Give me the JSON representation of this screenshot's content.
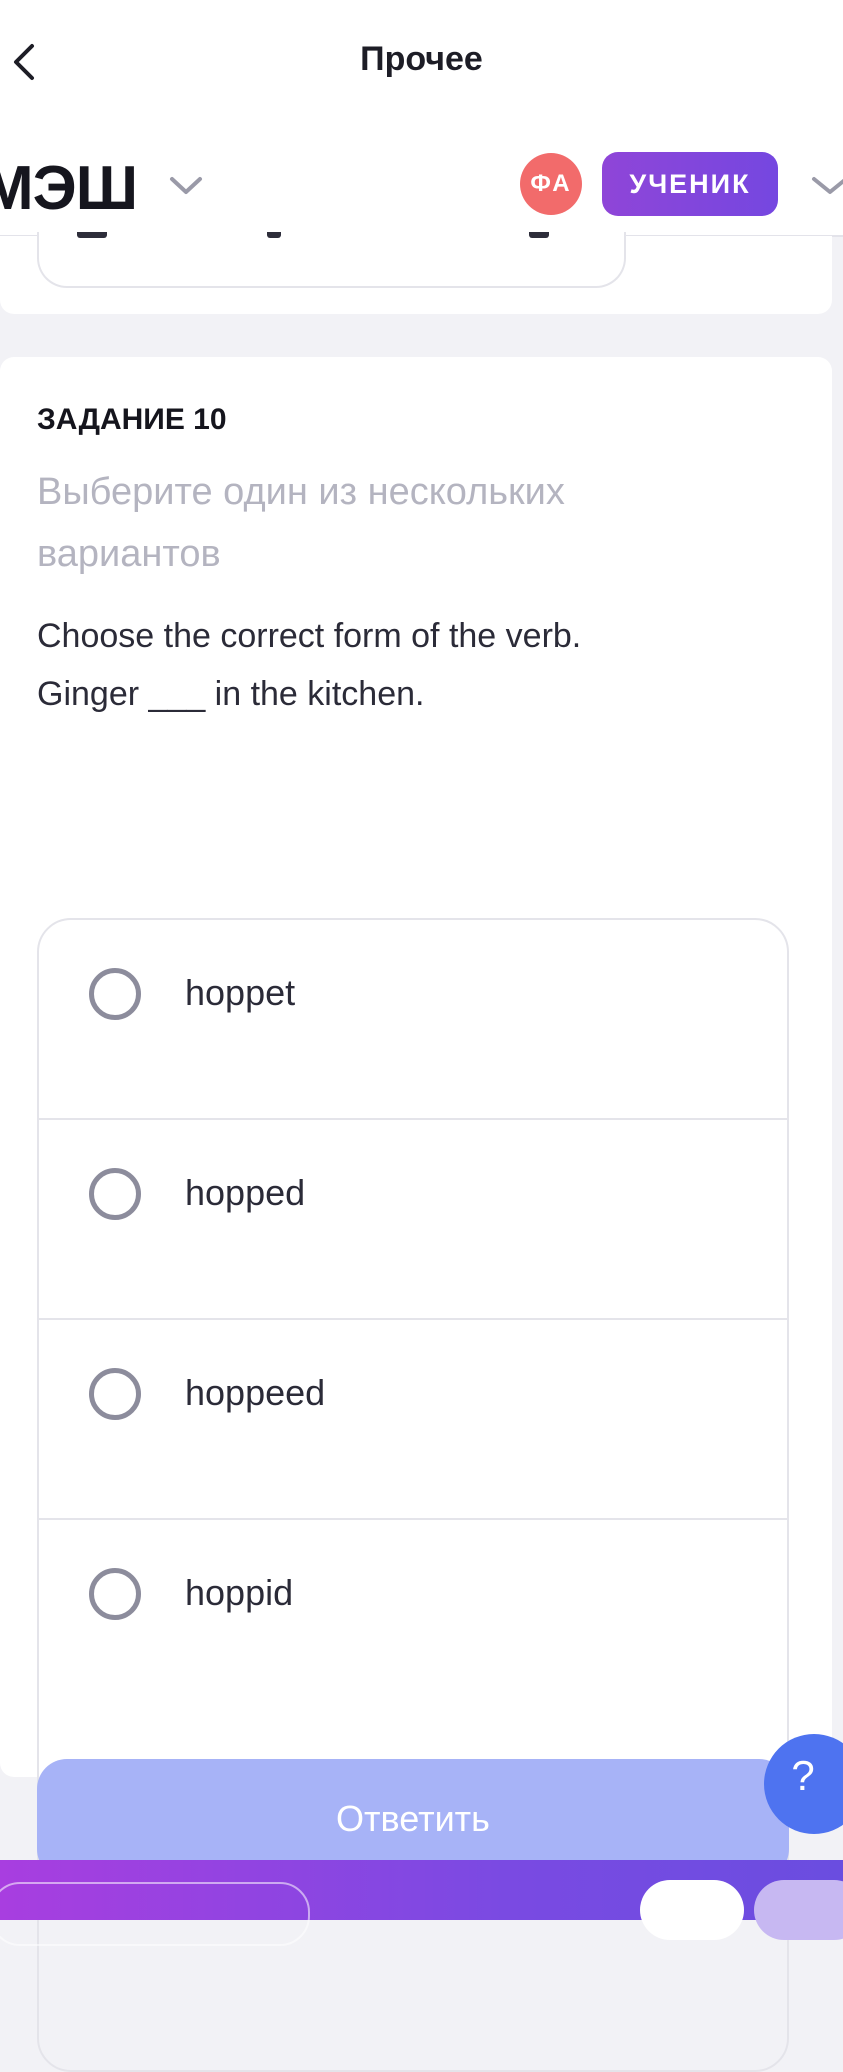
{
  "header": {
    "title": "Прочее",
    "back_icon": "chevron-left-icon"
  },
  "subheader": {
    "brand": "МЭШ",
    "avatar_initials": "ФА",
    "role": "УЧЕНИК",
    "avatar_color": "#f26b6b",
    "role_color": "#8f45d8"
  },
  "task": {
    "number_label": "ЗАДАНИЕ 10",
    "instruction": "Выберите один из нескольких вариантов",
    "question_lines": [
      "Choose the correct form of the verb.",
      "Ginger ___ in the kitchen."
    ],
    "options": [
      {
        "label": "hoppet",
        "selected": false
      },
      {
        "label": "hopped",
        "selected": false
      },
      {
        "label": "hoppeed",
        "selected": false
      },
      {
        "label": "hoppid",
        "selected": false
      }
    ]
  },
  "footer": {
    "submit_label": "Ответить",
    "help_label": "?",
    "submit_color": "#a7b3f7",
    "help_color": "#4e73f0"
  }
}
